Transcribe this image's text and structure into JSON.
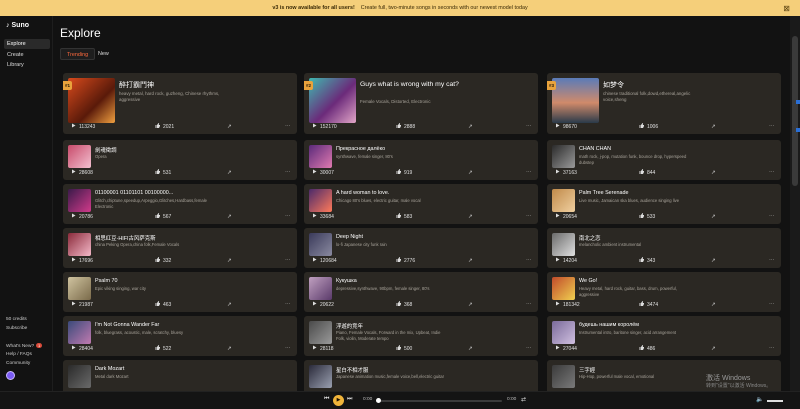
{
  "banner": {
    "headline": "v3 is now available for all users!",
    "message": "Create full, two-minute songs in seconds with our newest model today"
  },
  "sidebar": {
    "logo": "Suno",
    "nav": [
      "Explore",
      "Create",
      "Library"
    ],
    "credits": "50 credits",
    "subscribe": "Subscribe",
    "whats_new": "What's New?",
    "whats_new_count": "1",
    "help": "Help / FAQs",
    "community": "Community"
  },
  "page": {
    "title": "Explore",
    "tabs": [
      "Trending",
      "New"
    ]
  },
  "colors": {
    "accent": "#ff6a3d",
    "badge": "#e9a33c",
    "card": "#2b2823"
  },
  "top_cards": [
    {
      "rank": "#1",
      "title": "醉打霸鬥神",
      "tags": "heavy metal, hard rock, guzheng, Chinese rhythms, aggressive",
      "plays": "113243",
      "likes": "2021"
    },
    {
      "rank": "#2",
      "title": "Guys what is wrong with my cat?",
      "tags": "Female Vocals, Distorted, Electronic",
      "plays": "152170",
      "likes": "2888"
    },
    {
      "rank": "#3",
      "title": "如梦令",
      "tags": "chinese traditional folk,dowd,ethereal,angelic voice,sheng",
      "plays": "98670",
      "likes": "1006"
    }
  ],
  "cards": [
    {
      "title": "劍魂徵調",
      "tags": "Opera",
      "plays": "28608",
      "likes": "531"
    },
    {
      "title": "Прекрасное далёко",
      "tags": "synthwave, female singer, 80's",
      "plays": "30007",
      "likes": "919"
    },
    {
      "title": "CHAN CHAN",
      "tags": "math rock, j-pop, mutation funk, bounce drop, hyperspeed dubstep",
      "plays": "37163",
      "likes": "844"
    },
    {
      "title": "01100001 01101101 00100000...",
      "tags": "Glitch,chiptune,speedup,Arpeggio,Glitches,Hardbass,female,vocals,synthesizer..., Electronic",
      "plays": "20786",
      "likes": "567"
    },
    {
      "title": "A hard woman to love.",
      "tags": "Chicago 80's blues, electric guitar, male vocal",
      "plays": "33684",
      "likes": "583"
    },
    {
      "title": "Palm Tree Serenade",
      "tags": "Live music, Jamaican ska blues, audience singing live",
      "plays": "20654",
      "likes": "533"
    },
    {
      "title": "相思红豆-HIFI古风萨克斯",
      "tags": "china Peking Opera,china folk,Female Vocals",
      "plays": "17696",
      "likes": "332"
    },
    {
      "title": "Deep Night",
      "tags": "lo-fi Japanese city funk rain",
      "plays": "120684",
      "likes": "2776"
    },
    {
      "title": "南北之恋",
      "tags": "melancholic ambient instrumental",
      "plays": "14204",
      "likes": "343"
    },
    {
      "title": "Psalm 70",
      "tags": "Epic viking singing, war city",
      "plays": "21987",
      "likes": "463"
    },
    {
      "title": "Кукушка",
      "tags": "depressive,synthwave, 90bpm, female singer, 80's",
      "plays": "20622",
      "likes": "368"
    },
    {
      "title": "We Go!",
      "tags": "Heavy metal, hard rock, guitar, bass, drum, powerful, aggressive",
      "plays": "181342",
      "likes": "3474"
    },
    {
      "title": "I'm Not Gonna Wander Far",
      "tags": "folk, bluegrass, acoustic, male, scratchy, bluesy",
      "plays": "28404",
      "likes": "522"
    },
    {
      "title": "浮遊的竞年",
      "tags": "Piano, Female Vocals, Forward in the mix, Upbeat, Indie Folk, violin, Moderate tempo",
      "plays": "28118",
      "likes": "500"
    },
    {
      "title": "будешь нашим королём",
      "tags": "Instrumental intro, baritone singer, acid arrangement",
      "plays": "27044",
      "likes": "486"
    },
    {
      "title": "Dark Mozart",
      "tags": "Metal dark Mozart",
      "plays": "",
      "likes": ""
    },
    {
      "title": "星白不相才服",
      "tags": "Japanese animation music,female voice,bell,electric guitar",
      "plays": "",
      "likes": ""
    },
    {
      "title": "三字經",
      "tags": "Hip-Hop, powerful male vocal, emotional",
      "plays": "",
      "likes": ""
    }
  ],
  "player": {
    "time_start": "0:00",
    "time_end": "0:00"
  },
  "watermark": {
    "line1": "激活 Windows",
    "line2": "转到\"设置\"以激活 Windows。"
  }
}
